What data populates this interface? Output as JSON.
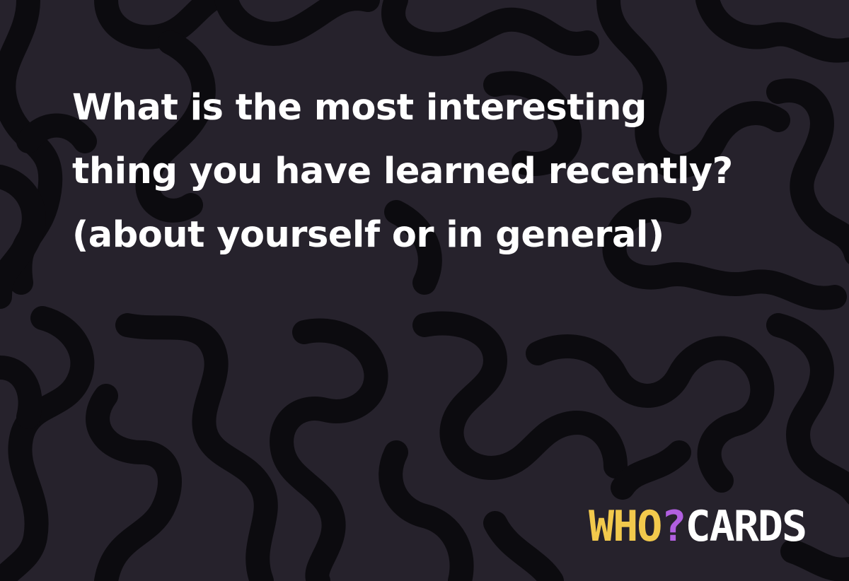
{
  "card": {
    "question": "What is the most interesting thing you have learned recently? (about yourself or in general)"
  },
  "brand": {
    "part1": "WHO",
    "question_mark": "?",
    "part2": "CARDS",
    "colors": {
      "who": "#f2c94c",
      "question_mark": "#b15fe0",
      "cards": "#ffffff"
    }
  },
  "colors": {
    "background": "#26222c",
    "pattern": "#0c0b0f",
    "text": "#ffffff"
  }
}
